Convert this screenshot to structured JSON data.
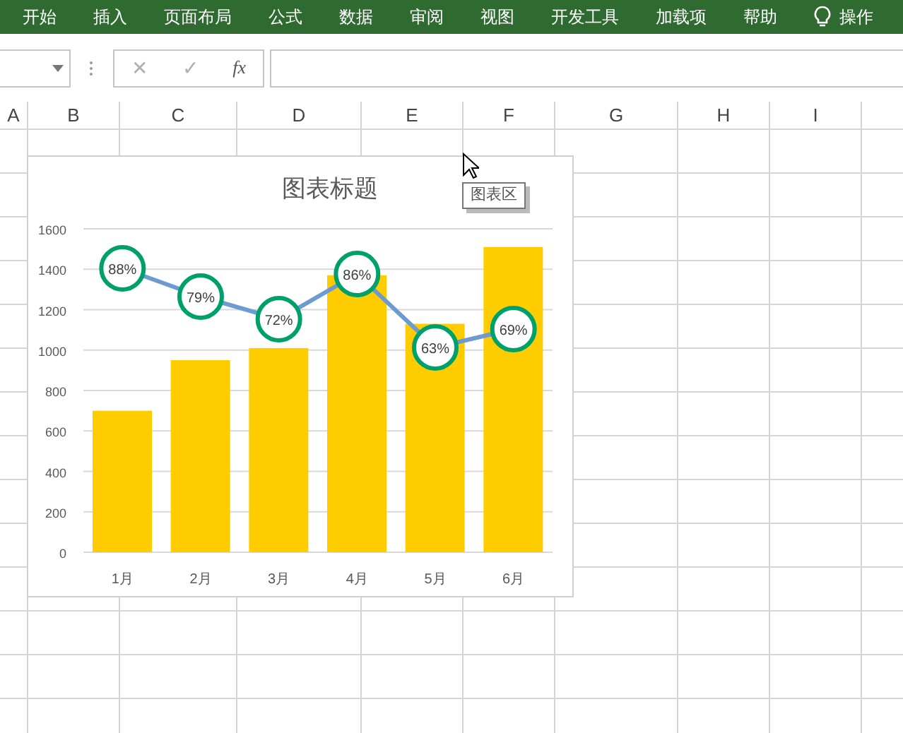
{
  "ribbon": {
    "tabs": [
      {
        "label": "开始"
      },
      {
        "label": "插入"
      },
      {
        "label": "页面布局"
      },
      {
        "label": "公式"
      },
      {
        "label": "数据"
      },
      {
        "label": "审阅"
      },
      {
        "label": "视图"
      },
      {
        "label": "开发工具"
      },
      {
        "label": "加载项"
      },
      {
        "label": "帮助"
      }
    ],
    "tell_me": "操作"
  },
  "formula_bar": {
    "cancel": "✕",
    "enter": "✓",
    "function": "fx"
  },
  "columns": [
    {
      "label": "A"
    },
    {
      "label": "B"
    },
    {
      "label": "C"
    },
    {
      "label": "D"
    },
    {
      "label": "E"
    },
    {
      "label": "F"
    },
    {
      "label": "G"
    },
    {
      "label": "H"
    },
    {
      "label": "I"
    }
  ],
  "chart": {
    "chart_data": {
      "type": "bar",
      "title": "图表标题",
      "categories": [
        "1月",
        "2月",
        "3月",
        "4月",
        "5月",
        "6月"
      ],
      "ylim": [
        0,
        1600
      ],
      "yticks": [
        0,
        200,
        400,
        600,
        800,
        1000,
        1200,
        1400,
        1600
      ],
      "grid": true,
      "series": [
        {
          "color": "#ffcc00",
          "values": [
            700,
            950,
            1010,
            1370,
            1130,
            1510
          ]
        }
      ]
    },
    "line_labels": [
      "88%",
      "79%",
      "72%",
      "86%",
      "63%",
      "69%"
    ],
    "tooltip": "图表区"
  }
}
